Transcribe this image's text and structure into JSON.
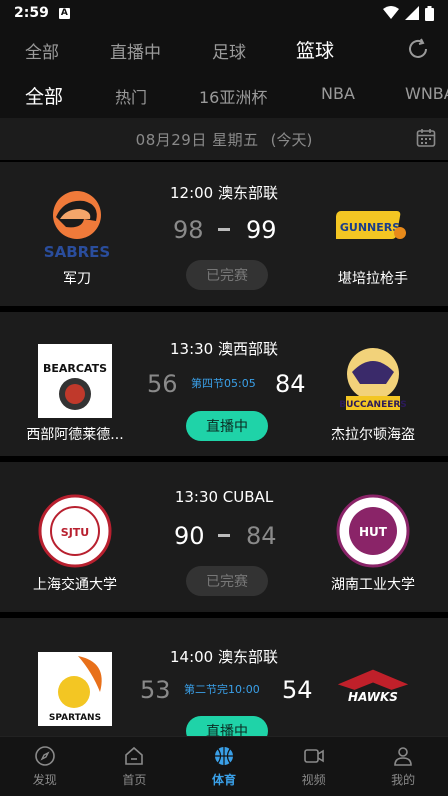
{
  "status": {
    "time": "2:59",
    "a_label": "A"
  },
  "top_tabs": [
    {
      "label": "全部"
    },
    {
      "label": "直播中"
    },
    {
      "label": "足球"
    },
    {
      "label": "篮球"
    }
  ],
  "sub_tabs": [
    {
      "label": "全部"
    },
    {
      "label": "热门"
    },
    {
      "label": "16亚洲杯"
    },
    {
      "label": "NBA"
    },
    {
      "label": "WNBA"
    }
  ],
  "date_bar": {
    "date": "08月29日 星期五",
    "today": "(今天)"
  },
  "matches": [
    {
      "league": "12:00 澳东部联",
      "home": {
        "name": "军刀",
        "score": "98",
        "logo_text": "SABRES"
      },
      "away": {
        "name": "堪培拉枪手",
        "score": "99",
        "logo_text": "GUNNERS"
      },
      "status_label": "已完赛",
      "period": ""
    },
    {
      "league": "13:30 澳西部联",
      "home": {
        "name": "西部阿德莱德...",
        "score": "56",
        "logo_text": "BEARCATS"
      },
      "away": {
        "name": "杰拉尔顿海盗",
        "score": "84",
        "logo_text": "BUCCANEERS"
      },
      "status_label": "直播中",
      "period": "第四节05:05"
    },
    {
      "league": "13:30 CUBAL",
      "home": {
        "name": "上海交通大学",
        "score": "90",
        "logo_text": "SJTU"
      },
      "away": {
        "name": "湖南工业大学",
        "score": "84",
        "logo_text": "HUT"
      },
      "status_label": "已完赛",
      "period": ""
    },
    {
      "league": "14:00 澳东部联",
      "home": {
        "name": "",
        "score": "53",
        "logo_text": "SPARTANS"
      },
      "away": {
        "name": "",
        "score": "54",
        "logo_text": "HAWKS"
      },
      "status_label": "直播中",
      "period": "第二节完10:00"
    }
  ],
  "bottom_nav": [
    {
      "label": "发现"
    },
    {
      "label": "首页"
    },
    {
      "label": "体育"
    },
    {
      "label": "视频"
    },
    {
      "label": "我的"
    }
  ],
  "colors": {
    "accent": "#3aa0e8",
    "live": "#1fd3a8",
    "card": "#1c1c1c"
  }
}
